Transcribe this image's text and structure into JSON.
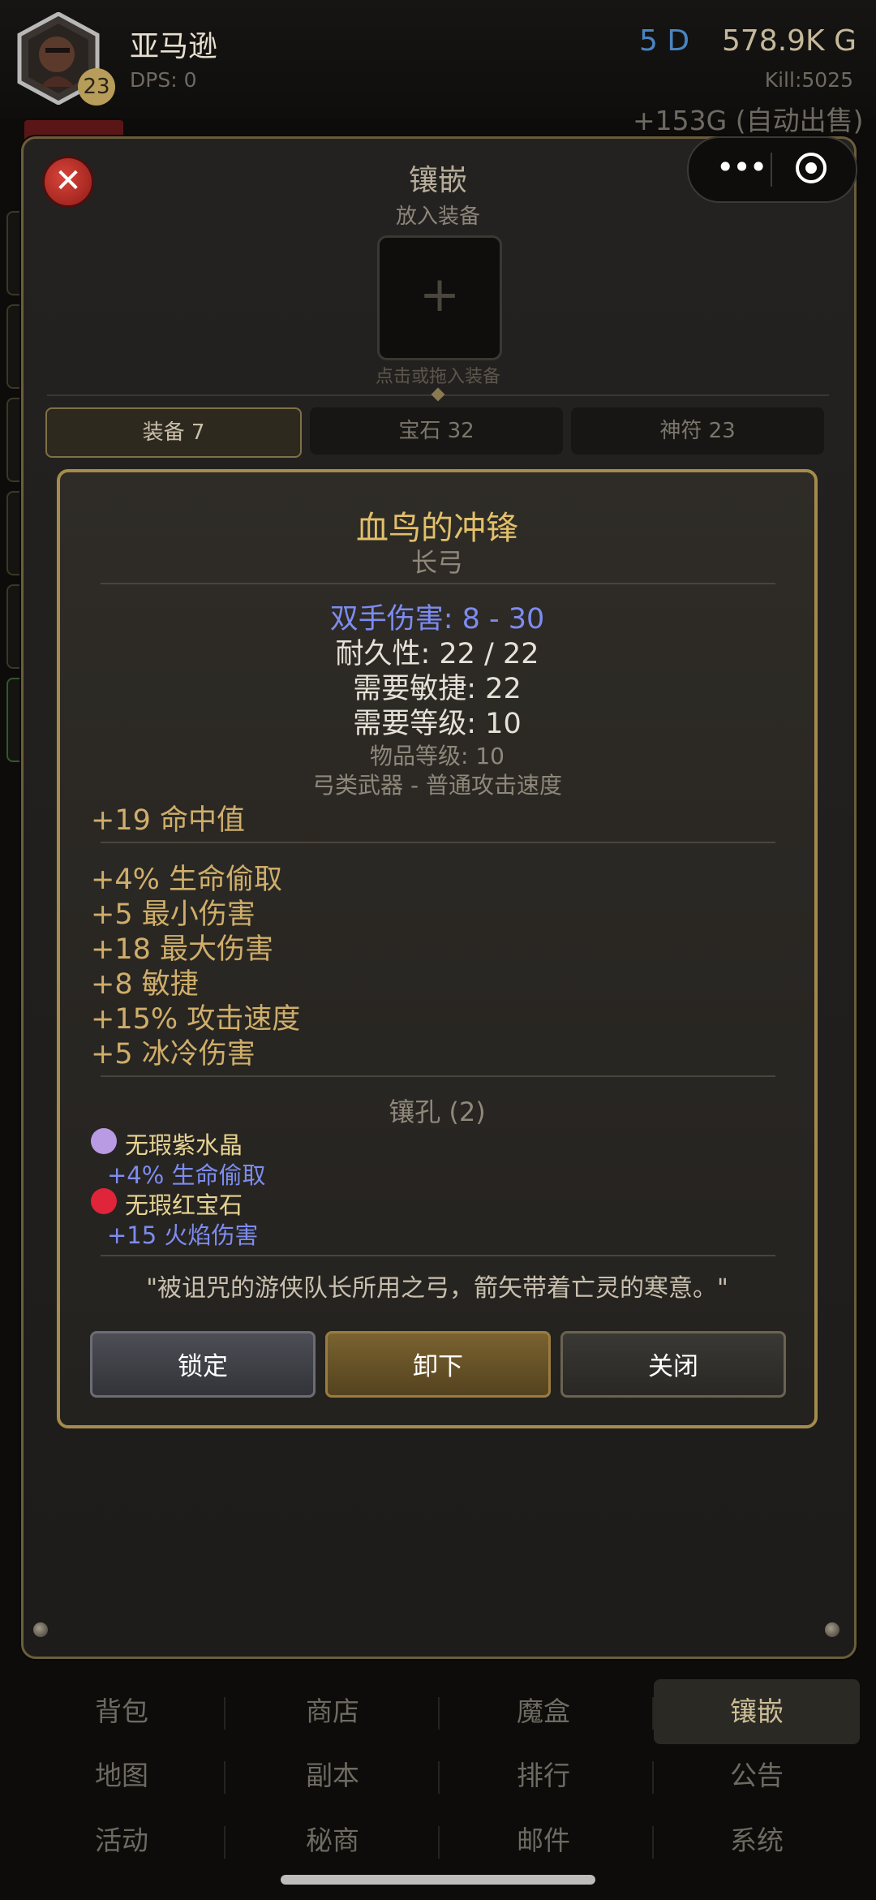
{
  "header": {
    "player_name": "亚马逊",
    "level": "23",
    "dps": "DPS: 0",
    "diamonds": "5 D",
    "gold": "578.9K G",
    "kills": "Kill:5025",
    "gold_message": "+153G (自动出售)"
  },
  "inlay_panel": {
    "title": "镶嵌",
    "subtitle": "放入装备",
    "slot_plus": "+",
    "slot_hint": "点击或拖入装备",
    "close_symbol": "✕",
    "tabs": [
      {
        "label": "装备 7",
        "active": true
      },
      {
        "label": "宝石 32",
        "active": false
      },
      {
        "label": "神符 23",
        "active": false
      }
    ]
  },
  "capsule": {
    "more_icon": "•••"
  },
  "item": {
    "name": "血鸟的冲锋",
    "type": "长弓",
    "damage": "双手伤害: 8 - 30",
    "durability": "耐久性: 22 / 22",
    "req_dex": "需要敏捷: 22",
    "req_level": "需要等级: 10",
    "item_level": "物品等级: 10",
    "weapon_class": "弓类武器 - 普通攻击速度",
    "base_mod": "+19 命中值",
    "mods": [
      "+4% 生命偷取",
      "+5 最小伤害",
      "+18 最大伤害",
      "+8 敏捷",
      "+15% 攻击速度",
      "+5 冰冷伤害"
    ],
    "sockets_title": "镶孔 (2)",
    "sockets": [
      {
        "gem": "无瑕紫水晶",
        "bonus": "+4% 生命偷取",
        "color": "#b99be3"
      },
      {
        "gem": "无瑕红宝石",
        "bonus": "+15 火焰伤害",
        "color": "#e0243a"
      }
    ],
    "flavor": "\"被诅咒的游侠队长所用之弓，箭矢带着亡灵的寒意。\"",
    "buttons": {
      "lock": "锁定",
      "unequip": "卸下",
      "close": "关闭"
    }
  },
  "bottom_nav": [
    [
      "背包",
      "商店",
      "魔盒",
      "镶嵌"
    ],
    [
      "地图",
      "副本",
      "排行",
      "公告"
    ],
    [
      "活动",
      "秘商",
      "邮件",
      "系统"
    ]
  ],
  "colors": {
    "accent_gold": "#a58b4c",
    "gem_blue": "#7d8cf0",
    "mod_gold": "#cfae6a"
  }
}
